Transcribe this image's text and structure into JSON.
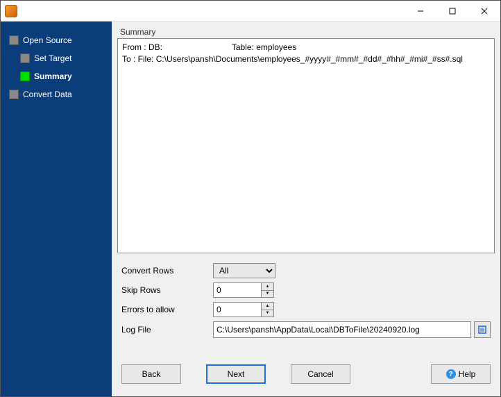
{
  "window": {
    "title": ""
  },
  "sidebar": {
    "items": [
      {
        "label": "Open Source",
        "active": false
      },
      {
        "label": "Set Target",
        "active": false
      },
      {
        "label": "Summary",
        "active": true
      },
      {
        "label": "Convert Data",
        "active": false
      }
    ]
  },
  "summary": {
    "heading": "Summary",
    "from_label": "From : DB:",
    "table_label": "Table:",
    "table_name": "employees",
    "to_label": "To : File:",
    "to_path": "C:\\Users\\pansh\\Documents\\employees_#yyyy#_#mm#_#dd#_#hh#_#mi#_#ss#.sql"
  },
  "fields": {
    "convert_rows": {
      "label": "Convert Rows",
      "value": "All"
    },
    "skip_rows": {
      "label": "Skip Rows",
      "value": "0"
    },
    "errors": {
      "label": "Errors to allow",
      "value": "0"
    },
    "log_file": {
      "label": "Log File",
      "value": "C:\\Users\\pansh\\AppData\\Local\\DBToFile\\20240920.log"
    }
  },
  "buttons": {
    "back": "Back",
    "next": "Next",
    "cancel": "Cancel",
    "help": "Help"
  }
}
